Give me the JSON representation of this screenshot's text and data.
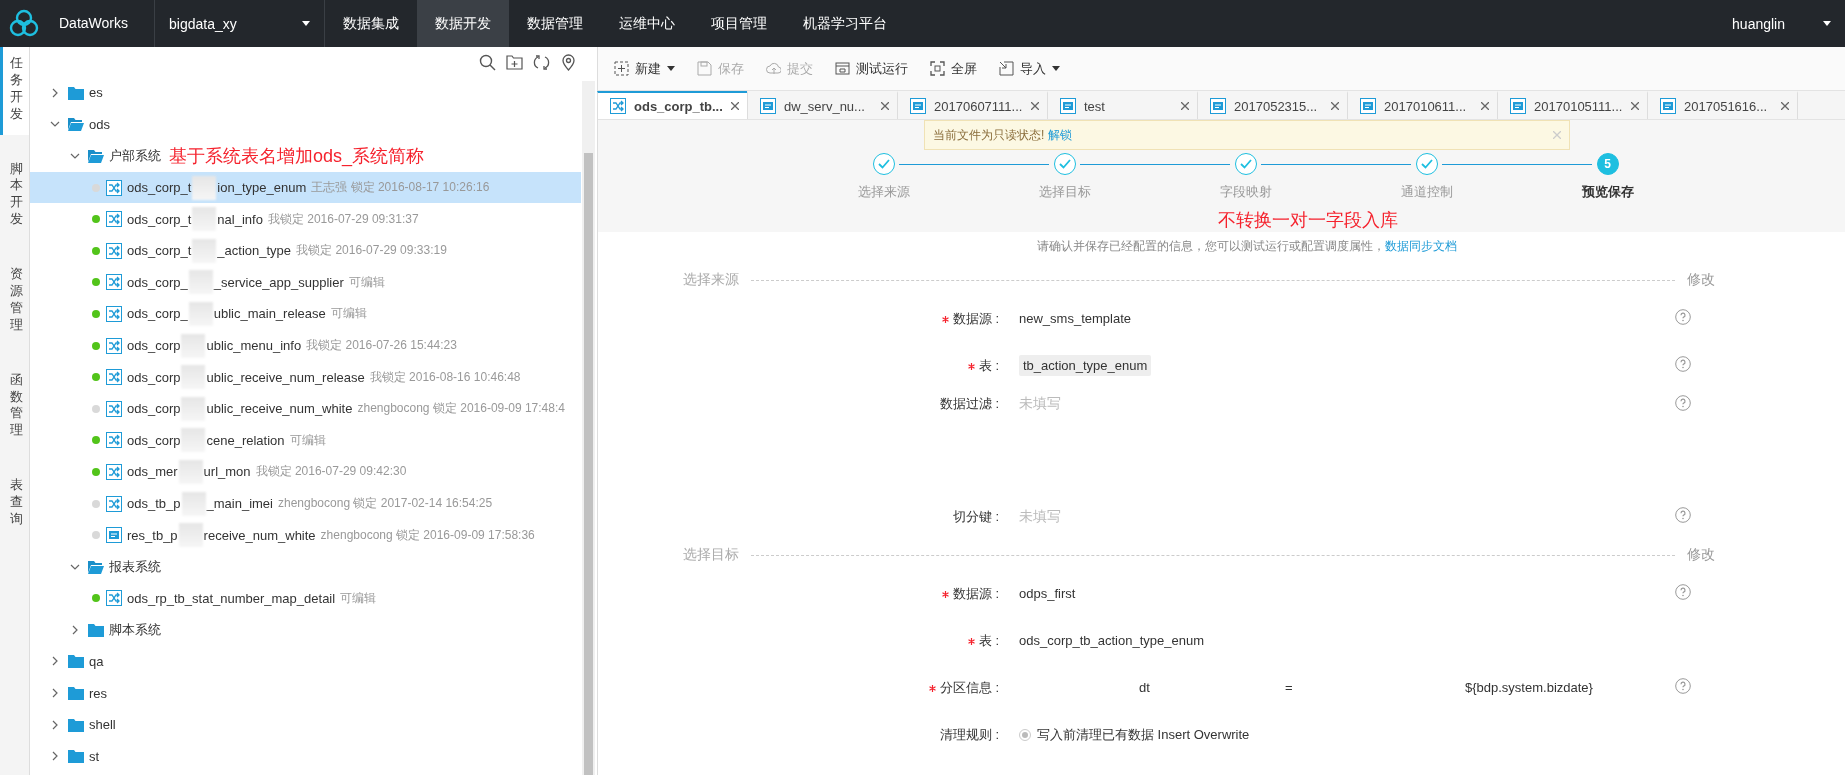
{
  "topbar": {
    "product": "DataWorks",
    "project": "bigdata_xy",
    "nav": [
      {
        "label": "数据集成",
        "selected": false
      },
      {
        "label": "数据开发",
        "selected": true
      },
      {
        "label": "数据管理",
        "selected": false
      },
      {
        "label": "运维中心",
        "selected": false
      },
      {
        "label": "项目管理",
        "selected": false
      },
      {
        "label": "机器学习平台",
        "selected": false
      }
    ],
    "user": "huanglin"
  },
  "side_tabs": [
    {
      "label": "任务开发",
      "selected": true
    },
    {
      "label": "脚本开发",
      "selected": false
    },
    {
      "label": "资源管理",
      "selected": false
    },
    {
      "label": "函数管理",
      "selected": false
    },
    {
      "label": "表查询",
      "selected": false
    }
  ],
  "tree": [
    {
      "kind": "folder",
      "name": "es",
      "expanded": false
    },
    {
      "kind": "folder",
      "name": "ods",
      "expanded": true,
      "children": [
        {
          "kind": "folder",
          "name": "户部系统",
          "expanded": true,
          "annotation": "基于系统表名增加ods_系统简称",
          "children": [
            {
              "kind": "sync",
              "name_parts": [
                "ods_corp_t",
                "ion_type_enum"
              ],
              "meta": "王志强 锁定 2016-08-17 10:26:16",
              "color": "#d9d9d9",
              "selected": true
            },
            {
              "kind": "sync",
              "name_parts": [
                "ods_corp_t",
                "nal_info"
              ],
              "meta": "我锁定 2016-07-29 09:31:37",
              "color": "#52c41a",
              "selected": false
            },
            {
              "kind": "sync",
              "name_parts": [
                "ods_corp_t",
                "_action_type"
              ],
              "meta": "我锁定 2016-07-29 09:33:19",
              "color": "#52c41a",
              "selected": false
            },
            {
              "kind": "sync",
              "name_parts": [
                "ods_corp_",
                "_service_app_supplier"
              ],
              "meta": "可编辑",
              "color": "#52c41a",
              "selected": false
            },
            {
              "kind": "sync",
              "name_parts": [
                "ods_corp_",
                "ublic_main_release"
              ],
              "meta": "可编辑",
              "color": "#52c41a",
              "selected": false
            },
            {
              "kind": "sync",
              "name_parts": [
                "ods_corp",
                "ublic_menu_info"
              ],
              "meta": "我锁定 2016-07-26 15:44:23",
              "color": "#52c41a",
              "selected": false
            },
            {
              "kind": "sync",
              "name_parts": [
                "ods_corp",
                "ublic_receive_num_release"
              ],
              "meta": "我锁定 2016-08-16 10:46:48",
              "color": "#52c41a",
              "selected": false
            },
            {
              "kind": "sync",
              "name_parts": [
                "ods_corp",
                "ublic_receive_num_white"
              ],
              "meta": "zhengbocong 锁定 2016-09-09 17:48:4",
              "color": "#d9d9d9",
              "selected": false
            },
            {
              "kind": "sync",
              "name_parts": [
                "ods_corp",
                "cene_relation"
              ],
              "meta": "可编辑",
              "color": "#52c41a",
              "selected": false
            },
            {
              "kind": "sync",
              "name_parts": [
                "ods_mer",
                "url_mon"
              ],
              "meta": "我锁定 2016-07-29 09:42:30",
              "color": "#52c41a",
              "selected": false
            },
            {
              "kind": "sync",
              "name_parts": [
                "ods_tb_p",
                "_main_imei"
              ],
              "meta": "zhengbocong 锁定 2017-02-14 16:54:25",
              "color": "#d9d9d9",
              "selected": false
            },
            {
              "kind": "sql",
              "name_parts": [
                "res_tb_p",
                "receive_num_white"
              ],
              "meta": "zhengbocong 锁定 2016-09-09 17:58:36",
              "color": "#d9d9d9",
              "selected": false
            }
          ]
        },
        {
          "kind": "folder",
          "name": "报表系统",
          "expanded": true,
          "children": [
            {
              "kind": "sync",
              "name_parts": [
                "ods_rp_tb_stat_number_map_detail"
              ],
              "meta": "可编辑",
              "color": "#52c41a",
              "selected": false
            }
          ]
        },
        {
          "kind": "folder",
          "name": "脚本系统",
          "expanded": false
        }
      ]
    },
    {
      "kind": "folder",
      "name": "qa",
      "expanded": false
    },
    {
      "kind": "folder",
      "name": "res",
      "expanded": false
    },
    {
      "kind": "folder",
      "name": "shell",
      "expanded": false
    },
    {
      "kind": "folder",
      "name": "st",
      "expanded": false
    }
  ],
  "toolbar": [
    {
      "label": "新建",
      "kind": "new",
      "disabled": false,
      "dropdown": true
    },
    {
      "label": "保存",
      "kind": "save",
      "disabled": true,
      "dropdown": false
    },
    {
      "label": "提交",
      "kind": "submit",
      "disabled": true,
      "dropdown": false
    },
    {
      "label": "测试运行",
      "kind": "run",
      "disabled": false,
      "dropdown": false
    },
    {
      "label": "全屏",
      "kind": "fullscreen",
      "disabled": false,
      "dropdown": false
    },
    {
      "label": "导入",
      "kind": "import",
      "disabled": false,
      "dropdown": true
    }
  ],
  "tabs": [
    {
      "label": "ods_corp_tb...",
      "kind": "sync",
      "selected": true
    },
    {
      "label": "dw_serv_nu...",
      "kind": "sql",
      "selected": false
    },
    {
      "label": "20170607111...",
      "kind": "sql",
      "selected": false
    },
    {
      "label": "test",
      "kind": "sql",
      "selected": false
    },
    {
      "label": "2017052315...",
      "kind": "sql",
      "selected": false
    },
    {
      "label": "2017010611...",
      "kind": "sql",
      "selected": false
    },
    {
      "label": "20170105111...",
      "kind": "sql",
      "selected": false
    },
    {
      "label": "2017051616...",
      "kind": "sql",
      "selected": false
    }
  ],
  "notice": {
    "text": "当前文件为只读状态!",
    "link": "解锁"
  },
  "steps": [
    {
      "label": "选择来源",
      "done": true
    },
    {
      "label": "选择目标",
      "done": true
    },
    {
      "label": "字段映射",
      "done": true
    },
    {
      "label": "通道控制",
      "done": true
    },
    {
      "label": "预览保存",
      "done": false,
      "number": "5"
    }
  ],
  "annotation": "不转换一对一字段入库",
  "description": {
    "text": "请确认并保存已经配置的信息，您可以测试运行或配置调度属性，",
    "link": "数据同步文档"
  },
  "sections": [
    {
      "title": "选择来源",
      "action": "修改",
      "fields": [
        {
          "label": "数据源 :",
          "required": true,
          "kind": "text",
          "value": "new_sms_template",
          "help": true
        },
        {
          "label": "表 :",
          "required": true,
          "kind": "tag",
          "value": "tb_action_type_enum",
          "help": true
        },
        {
          "label": "数据过滤 :",
          "required": false,
          "kind": "empty",
          "value": "未填写",
          "help": true,
          "tall": true
        },
        {
          "label": "切分键 :",
          "required": false,
          "kind": "empty",
          "value": "未填写",
          "help": true
        }
      ]
    },
    {
      "title": "选择目标",
      "action": "修改",
      "fields": [
        {
          "label": "数据源 :",
          "required": true,
          "kind": "text",
          "value": "odps_first",
          "help": true
        },
        {
          "label": "表 :",
          "required": true,
          "kind": "text",
          "value": "ods_corp_tb_action_type_enum",
          "help": false
        },
        {
          "label": "分区信息 :",
          "required": true,
          "kind": "partition",
          "parts": [
            "dt",
            "=",
            "${bdp.system.bizdate}"
          ],
          "help": true
        },
        {
          "label": "清理规则 :",
          "required": false,
          "kind": "radio",
          "value": "写入前清理已有数据 Insert Overwrite",
          "selected": true,
          "help": false
        }
      ]
    }
  ]
}
